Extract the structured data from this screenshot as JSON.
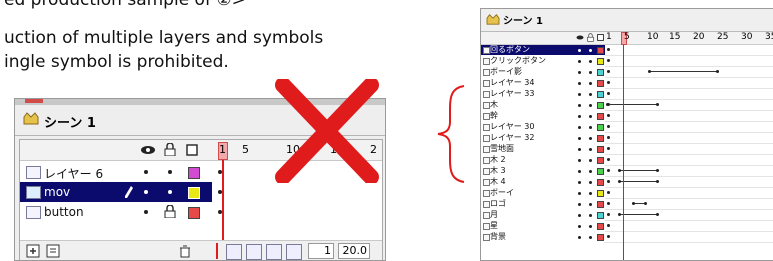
{
  "caption": {
    "line1": "ed production sample of ②>",
    "line2": "uction of multiple layers and symbols",
    "line3": "ingle symbol is prohibited."
  },
  "left_timeline": {
    "scene_label": "シーン 1",
    "frame_numbers": [
      "1",
      "5",
      "10",
      "1",
      "2"
    ],
    "layers": [
      {
        "name": "レイヤー 6",
        "selected": false,
        "color": "#d24bd2"
      },
      {
        "name": "mov",
        "selected": true,
        "color": "#e8e817"
      },
      {
        "name": "button",
        "selected": false,
        "color": "#e84848"
      }
    ],
    "current_frame": "1",
    "fps": "20.0"
  },
  "right_timeline": {
    "scene_label": "シーン 1",
    "frame_numbers": [
      "1",
      "5",
      "10",
      "15",
      "20",
      "25",
      "30",
      "35"
    ],
    "layers": [
      {
        "name": "回るボタン",
        "color": "#e84848",
        "selected": true
      },
      {
        "name": "クリックボタン",
        "color": "#e8e817",
        "selected": false
      },
      {
        "name": "ボーイ影",
        "color": "#4bd2d2",
        "selected": false
      },
      {
        "name": "レイヤー 34",
        "color": "#e84848",
        "selected": false
      },
      {
        "name": "レイヤー 33",
        "color": "#4bd2d2",
        "selected": false
      },
      {
        "name": "木",
        "color": "#4bd24b",
        "selected": false
      },
      {
        "name": "幹",
        "color": "#e84848",
        "selected": false
      },
      {
        "name": "レイヤー 30",
        "color": "#4bd24b",
        "selected": false
      },
      {
        "name": "レイヤー 32",
        "color": "#e84848",
        "selected": false
      },
      {
        "name": "雪地面",
        "color": "#e84848",
        "selected": false
      },
      {
        "name": "木 2",
        "color": "#e84848",
        "selected": false
      },
      {
        "name": "木 3",
        "color": "#4bd24b",
        "selected": false
      },
      {
        "name": "木 4",
        "color": "#e84848",
        "selected": false
      },
      {
        "name": "ボーイ",
        "color": "#e8e817",
        "selected": false
      },
      {
        "name": "ロゴ",
        "color": "#e84848",
        "selected": false
      },
      {
        "name": "月",
        "color": "#4bd2d2",
        "selected": false
      },
      {
        "name": "星",
        "color": "#e84848",
        "selected": false
      },
      {
        "name": "背景",
        "color": "#e84848",
        "selected": false
      }
    ]
  },
  "colors": {
    "cross": "#e01b1b",
    "bracket": "#e01b1b",
    "playhead": "#e01b1b",
    "selected_row": "#0b0b6e"
  },
  "icons": [
    "scene-icon",
    "eye-icon",
    "lock-icon",
    "outline-icon",
    "layer-icon",
    "pencil-icon",
    "trash-icon",
    "add-layer-icon",
    "add-folder-icon"
  ]
}
